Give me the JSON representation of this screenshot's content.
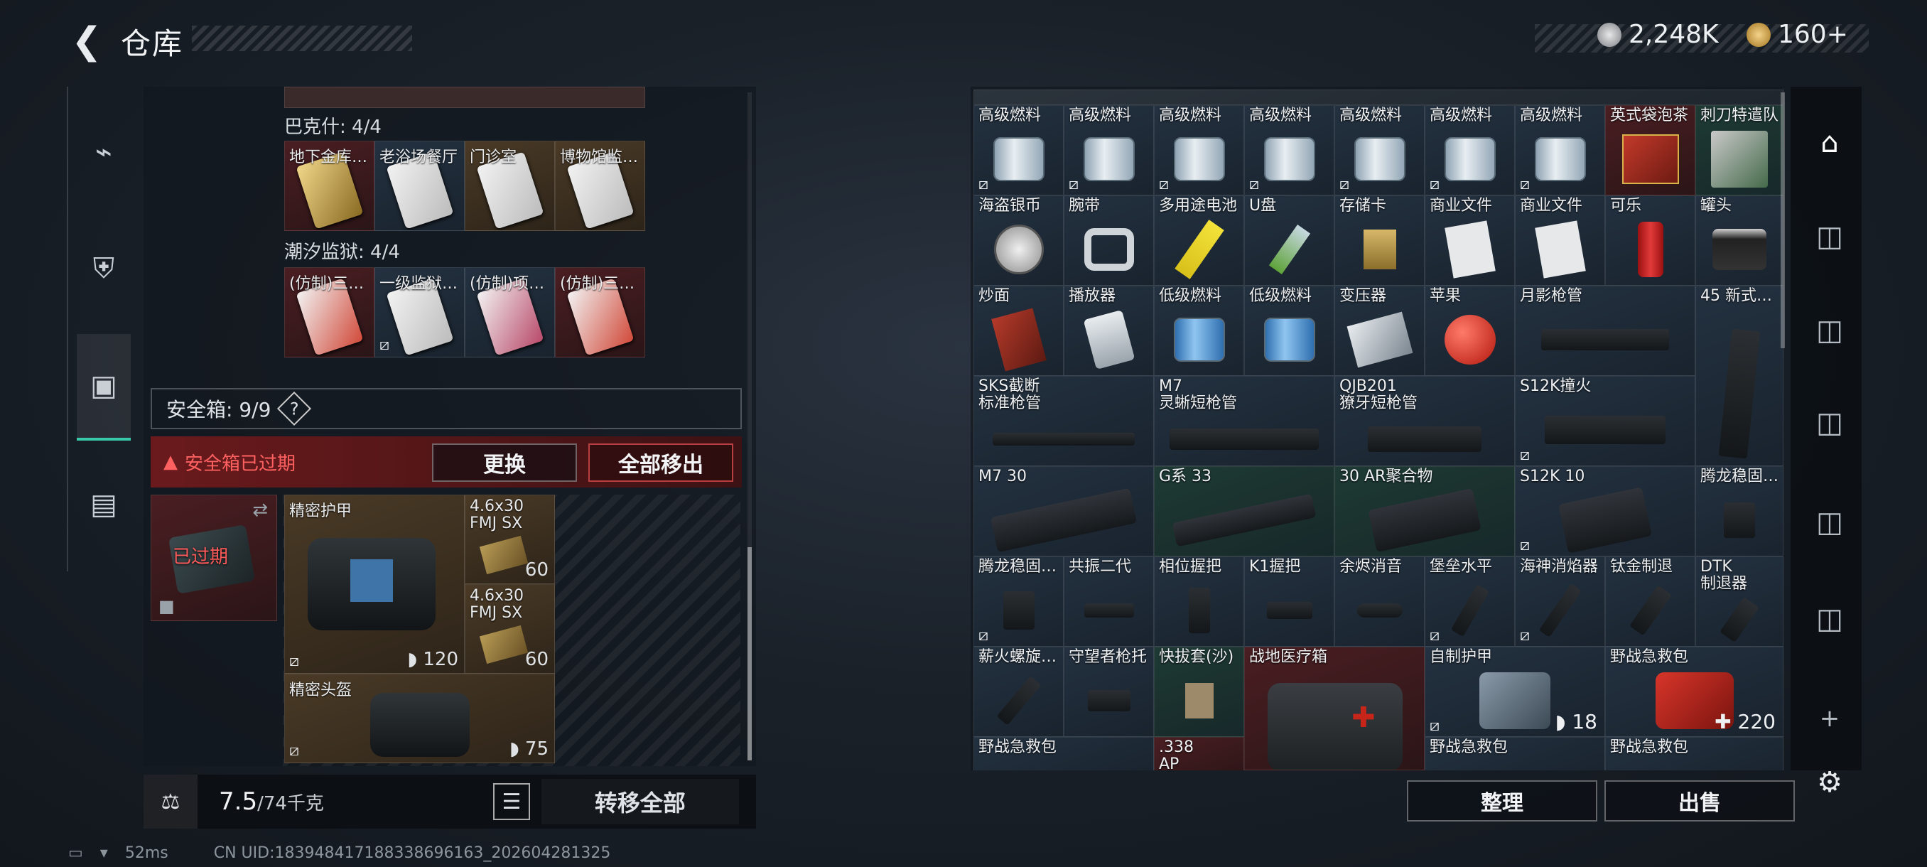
{
  "header": {
    "title": "仓库",
    "currency1": "2,248K",
    "currency2": "160+"
  },
  "left_tabs": [
    {
      "name": "weapon-tab",
      "icon": "gun-icon"
    },
    {
      "name": "armor-tab",
      "icon": "vest-icon"
    },
    {
      "name": "backpack-tab",
      "icon": "backpack-icon",
      "active": true
    },
    {
      "name": "case-tab",
      "icon": "briefcase-icon"
    }
  ],
  "keys": {
    "bakeshi": {
      "label": "巴克什: 4/4",
      "items": [
        "地下金库…",
        "老浴场餐厅",
        "门诊室",
        "博物馆监…"
      ]
    },
    "chaoxi": {
      "label": "潮汐监狱: 4/4",
      "items": [
        "(仿制)三…",
        "一级监狱…",
        "(仿制)项…",
        "(仿制)三…"
      ]
    }
  },
  "safebox": {
    "label": "安全箱: 9/9",
    "help": "?",
    "expired_text": "安全箱已过期",
    "expired_badge": "已过期",
    "replace_btn": "更换",
    "remove_all_btn": "全部移出"
  },
  "safe_items": {
    "armor": {
      "label": "精密护甲",
      "value": "120"
    },
    "ammo1": {
      "label": "4.6x30 FMJ SX",
      "count": "60"
    },
    "ammo2": {
      "label": "4.6x30 FMJ SX",
      "count": "60"
    },
    "helmet": {
      "label": "精密头盔",
      "value": "75"
    }
  },
  "weight": {
    "current": "7.5",
    "max": "/74千克",
    "transfer_all": "转移全部"
  },
  "storage": {
    "row1": [
      "高级燃料",
      "高级燃料",
      "高级燃料",
      "高级燃料",
      "高级燃料",
      "高级燃料",
      "高级燃料",
      "英式袋泡茶",
      "刺刀特遣队"
    ],
    "row2": [
      "海盗银币",
      "腕带",
      "多用途电池",
      "U盘",
      "存储卡",
      "商业文件",
      "商业文件",
      "可乐",
      "罐头"
    ],
    "row3": [
      "炒面",
      "播放器",
      "低级燃料",
      "低级燃料",
      "变压器",
      "苹果",
      "月影枪管",
      "45 新式…"
    ],
    "row4": [
      "SKS截断\n标准枪管",
      "M7\n灵蜥短枪管",
      "QJB201\n獠牙短枪管",
      "S12K撞火"
    ],
    "row5": [
      "M7 30",
      "G系 33",
      "30 AR聚合物",
      "S12K 10",
      "腾龙稳固…"
    ],
    "row6": [
      "腾龙稳固…",
      "共振二代",
      "相位握把",
      "K1握把",
      "余烬消音",
      "堡垒水平",
      "海神消焰器",
      "钛金制退",
      "DTK\n制退器"
    ],
    "row7": [
      "薪火螺旋…",
      "守望者枪托",
      "快拔套(沙)",
      "战地医疗箱",
      "自制护甲",
      "野战急救包"
    ],
    "row8": [
      "野战急救包",
      "",
      "",
      "",
      "野战急救包",
      "野战急救包"
    ],
    "row8b": ".338\nAP",
    "armor_value": "18",
    "medkit_value": "220"
  },
  "actions": {
    "sort": "整理",
    "sell": "出售"
  },
  "status": {
    "ping": "52ms",
    "uid": "CN UID:18394841718833869616​3_202604281325"
  }
}
